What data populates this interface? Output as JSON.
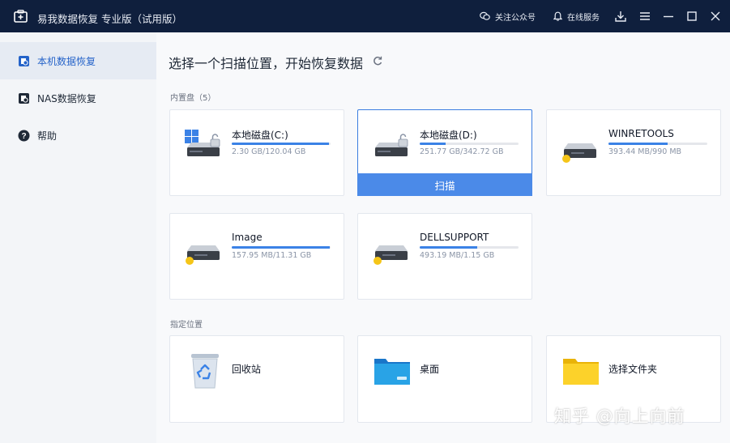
{
  "titlebar": {
    "title": "易我数据恢复 专业版（试用版）",
    "follow_label": "关注公众号",
    "service_label": "在线服务",
    "icons": [
      "app-logo-icon",
      "chat-bubble-icon",
      "bell-icon",
      "download-icon",
      "menu-icon",
      "minimize-icon",
      "maximize-icon",
      "close-icon"
    ]
  },
  "sidebar": {
    "items": [
      {
        "label": "本机数据恢复",
        "icon": "local-recovery-icon",
        "active": true
      },
      {
        "label": "NAS数据恢复",
        "icon": "nas-recovery-icon",
        "active": false
      },
      {
        "label": "帮助",
        "icon": "help-icon",
        "active": false
      }
    ]
  },
  "main": {
    "title": "选择一个扫描位置，开始恢复数据",
    "internal_section_label": "内置盘（5）",
    "locations_section_label": "指定位置",
    "scan_label": "扫描",
    "drives": [
      {
        "name": "本地磁盘(C:)",
        "size": "2.30 GB/120.04 GB",
        "used_fraction": 0.98,
        "icon": "windows-system-drive-icon"
      },
      {
        "name": "本地磁盘(D:)",
        "size": "251.77 GB/342.72 GB",
        "used_fraction": 0.26,
        "icon": "locked-drive-icon"
      },
      {
        "name": "WINRETOOLS",
        "size": "393.44 MB/990 MB",
        "used_fraction": 0.6,
        "icon": "external-drive-icon"
      },
      {
        "name": "Image",
        "size": "157.95 MB/11.31 GB",
        "used_fraction": 0.99,
        "icon": "external-drive-icon"
      },
      {
        "name": "DELLSUPPORT",
        "size": "493.19 MB/1.15 GB",
        "used_fraction": 0.58,
        "icon": "external-drive-icon"
      }
    ],
    "locations": [
      {
        "name": "回收站",
        "icon": "recycle-bin-icon"
      },
      {
        "name": "桌面",
        "icon": "desktop-folder-icon"
      },
      {
        "name": "选择文件夹",
        "icon": "folder-icon"
      }
    ]
  },
  "colors": {
    "titlebar": "#0f1f3d",
    "accent": "#3b82e6",
    "scan_button": "#4b8ae8",
    "sidebar_bg": "#f3f5f8",
    "drive_badge": "#f5c518"
  },
  "watermark": "知乎 @向上向前"
}
